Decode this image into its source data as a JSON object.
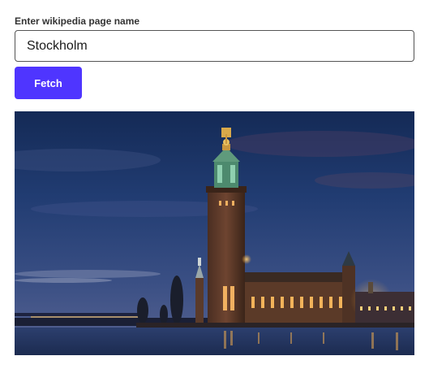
{
  "form": {
    "label": "Enter wikipedia page name",
    "input_value": "Stockholm",
    "button_label": "Fetch"
  },
  "result": {
    "image_subject": "stockholm-city-hall-night-photo"
  },
  "colors": {
    "accent": "#4f35ff",
    "input_border": "#555555",
    "label_text": "#333333"
  }
}
